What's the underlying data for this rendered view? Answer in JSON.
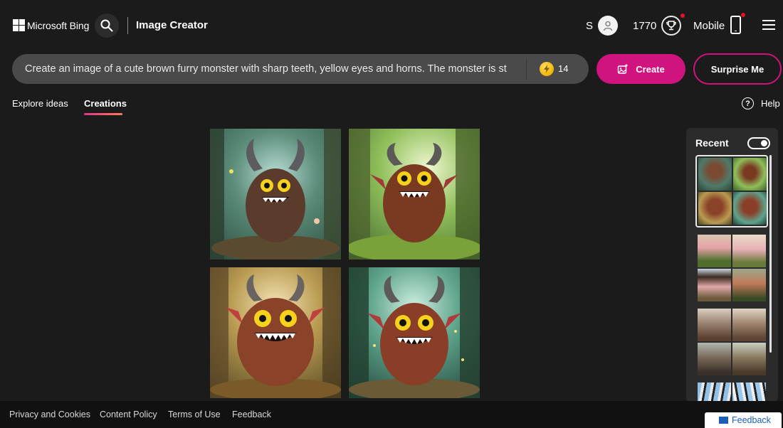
{
  "header": {
    "brand": "Microsoft Bing",
    "app_title": "Image Creator",
    "user_initial": "S",
    "points": "1770",
    "mobile_label": "Mobile"
  },
  "prompt": {
    "value": "Create an image of a cute brown furry monster with sharp teeth, yellow eyes and horns. The monster is st",
    "boosts": "14",
    "create_label": "Create",
    "surprise_label": "Surprise Me"
  },
  "tabs": {
    "explore": "Explore ideas",
    "creations": "Creations",
    "active": "Creations"
  },
  "help_label": "Help",
  "recent": {
    "title": "Recent",
    "toggle_on": true
  },
  "footer": {
    "privacy": "Privacy and Cookies",
    "content_policy": "Content Policy",
    "terms": "Terms of Use",
    "feedback": "Feedback"
  },
  "feedback_button": "Feedback",
  "colors": {
    "accent": "#d0137e",
    "background": "#1b1b1b",
    "prompt_bg": "#4a4a4a",
    "panel_bg": "#2b2b2b"
  }
}
